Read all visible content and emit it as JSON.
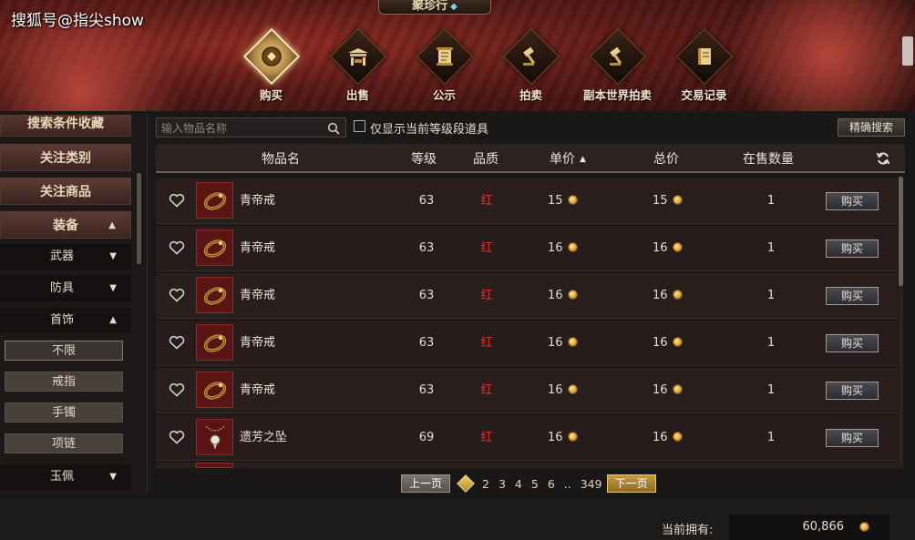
{
  "watermark": "搜狐号@指尖show",
  "title": "聚珍行",
  "nav": [
    {
      "label": "购买",
      "icon": "coin-icon",
      "active": true
    },
    {
      "label": "出售",
      "icon": "stall-icon"
    },
    {
      "label": "公示",
      "icon": "scroll-icon"
    },
    {
      "label": "拍卖",
      "icon": "gavel-icon"
    },
    {
      "label": "副本世界拍卖",
      "icon": "gavel-icon"
    },
    {
      "label": "交易记录",
      "icon": "book-icon"
    }
  ],
  "sidebar": {
    "saved_search": "搜索条件收藏",
    "watch_category": "关注类别",
    "watch_item": "关注商品",
    "equipment": "装备",
    "weapons": "武器",
    "armor": "防具",
    "jewelry": "首饰",
    "leaf_all": "不限",
    "leaf_ring": "戒指",
    "leaf_bracelet": "手镯",
    "leaf_necklace": "项链",
    "jade": "玉佩"
  },
  "search": {
    "placeholder": "输入物品名称",
    "checkbox_label": "仅显示当前等级段道具",
    "precise_button": "精确搜索"
  },
  "table": {
    "headers": {
      "name": "物品名",
      "level": "等级",
      "quality": "品质",
      "unit_price": "单价",
      "total_price": "总价",
      "quantity": "在售数量"
    },
    "buy_label": "购买",
    "rows": [
      {
        "name": "青帝戒",
        "level": "63",
        "quality": "红",
        "unit_price": "15",
        "total_price": "15",
        "quantity": "1",
        "item": "ring"
      },
      {
        "name": "青帝戒",
        "level": "63",
        "quality": "红",
        "unit_price": "16",
        "total_price": "16",
        "quantity": "1",
        "item": "ring"
      },
      {
        "name": "青帝戒",
        "level": "63",
        "quality": "红",
        "unit_price": "16",
        "total_price": "16",
        "quantity": "1",
        "item": "ring"
      },
      {
        "name": "青帝戒",
        "level": "63",
        "quality": "红",
        "unit_price": "16",
        "total_price": "16",
        "quantity": "1",
        "item": "ring"
      },
      {
        "name": "青帝戒",
        "level": "63",
        "quality": "红",
        "unit_price": "16",
        "total_price": "16",
        "quantity": "1",
        "item": "ring"
      },
      {
        "name": "遗芳之坠",
        "level": "69",
        "quality": "红",
        "unit_price": "16",
        "total_price": "16",
        "quantity": "1",
        "item": "pendant"
      }
    ]
  },
  "pager": {
    "prev": "上一页",
    "pages": [
      "2",
      "3",
      "4",
      "5",
      "6",
      "..",
      "349"
    ],
    "next": "下一页"
  },
  "wallet": {
    "label": "当前拥有:",
    "amount": "60,866"
  },
  "colors": {
    "quality_red": "#e0332c",
    "accent_gold": "#d7a23a"
  }
}
